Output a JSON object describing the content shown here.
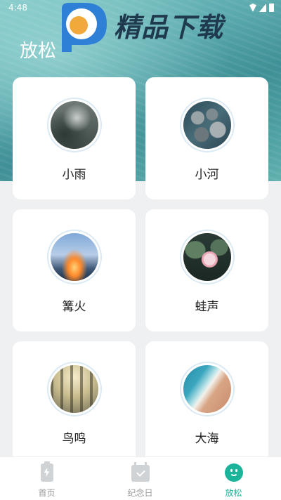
{
  "status_bar": {
    "time": "4:48"
  },
  "watermark": {
    "text": "精品下载",
    "subtitle": ""
  },
  "page": {
    "title": "放松"
  },
  "sounds": [
    {
      "label": "小雨",
      "image": "rain-window-photo"
    },
    {
      "label": "小河",
      "image": "river-stones-photo"
    },
    {
      "label": "篝火",
      "image": "campfire-photo"
    },
    {
      "label": "蛙声",
      "image": "lotus-pond-photo"
    },
    {
      "label": "鸟鸣",
      "image": "forest-photo"
    },
    {
      "label": "大海",
      "image": "sea-beach-photo"
    }
  ],
  "tabbar": {
    "items": [
      {
        "label": "首页",
        "icon": "battery-bolt-icon"
      },
      {
        "label": "纪念日",
        "icon": "calendar-check-icon"
      },
      {
        "label": "放松",
        "icon": "smile-icon",
        "active": true
      }
    ],
    "active_color": "#1bb49a",
    "inactive_color": "#9a9a9a"
  }
}
